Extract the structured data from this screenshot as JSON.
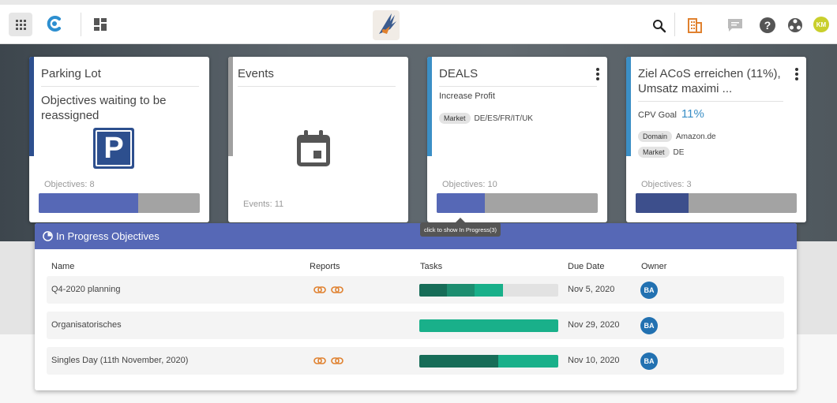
{
  "topbar": {
    "apps_icon": "apps-grid-icon",
    "brand_icon": "brand-c-icon",
    "dashboard_icon": "dashboard-icon",
    "logo_icon": "bird-logo-icon",
    "search_icon": "search-icon",
    "building_icon": "building-icon",
    "chat_icon": "chat-icon",
    "help_label": "?",
    "globe_icon": "globe-icon",
    "avatar_initials": "KM",
    "avatar_color": "#c9cf2c"
  },
  "cards": [
    {
      "title": "Parking Lot",
      "subtitle": "Objectives waiting to be reassigned",
      "objectives_label": "Objectives: 8",
      "progress": 0.62,
      "accent": "#2d4f8e"
    },
    {
      "title": "Events",
      "events_label": "Events: 11",
      "accent": "#a0a0a0"
    },
    {
      "title": "DEALS",
      "subtitle": "Increase Profit",
      "tags": [
        {
          "chip": "Market",
          "value": "DE/ES/FR/IT/UK"
        }
      ],
      "objectives_label": "Objectives: 10",
      "progress": 0.3,
      "accent": "#3b8fc6"
    },
    {
      "title": "Ziel ACoS erreichen (11%), Umsatz maximi ...",
      "cpv_label": "CPV Goal",
      "cpv_value": "11%",
      "tags": [
        {
          "chip": "Domain",
          "value": "Amazon.de"
        },
        {
          "chip": "Market",
          "value": "DE"
        }
      ],
      "objectives_label": "Objectives: 3",
      "progress": 0.33,
      "accent": "#3b8fc6",
      "bar_color": "#3d4f8c"
    }
  ],
  "tooltip": "click to show In Progress(3)",
  "panel": {
    "title": "In Progress Objectives",
    "columns": {
      "name": "Name",
      "reports": "Reports",
      "tasks": "Tasks",
      "due": "Due Date",
      "owner": "Owner"
    },
    "rows": [
      {
        "name": "Q4-2020 planning",
        "has_reports": true,
        "tasks": [
          0.2,
          0.2,
          0.2
        ],
        "due": "Nov 5, 2020",
        "owner": "BA"
      },
      {
        "name": "Organisatorisches",
        "has_reports": false,
        "tasks": [
          0,
          0,
          1.0
        ],
        "due": "Nov 29, 2020",
        "owner": "BA"
      },
      {
        "name": "Singles Day (11th November, 2020)",
        "has_reports": true,
        "tasks": [
          0.57,
          0,
          0.43
        ],
        "due": "Nov 10, 2020",
        "owner": "BA"
      }
    ],
    "task_colors": [
      "#176d58",
      "#1d8e70",
      "#19b08a"
    ]
  }
}
